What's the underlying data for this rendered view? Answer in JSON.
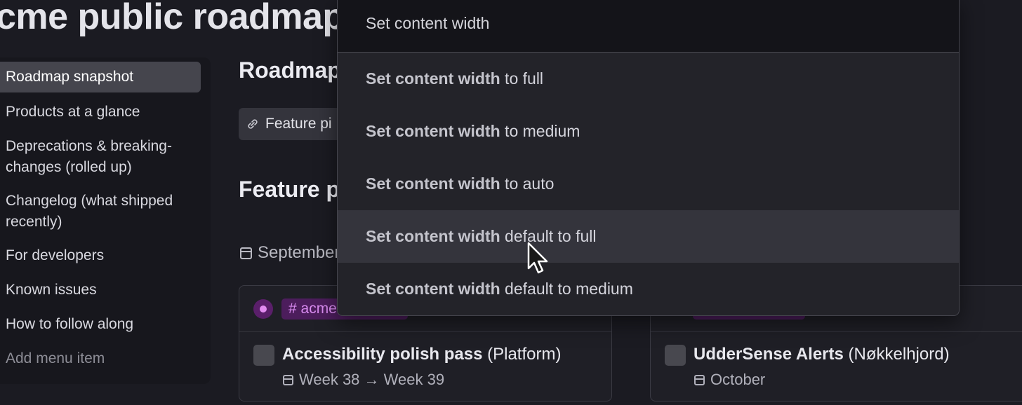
{
  "page_title": "cme public roadmap",
  "sidebar": {
    "items": [
      {
        "label": "Roadmap snapshot"
      },
      {
        "label": "Products at a glance"
      },
      {
        "label": "Deprecations & breaking-changes (rolled up)"
      },
      {
        "label": "Changelog (what shipped recently)"
      },
      {
        "label": "For developers"
      },
      {
        "label": "Known issues"
      },
      {
        "label": "How to follow along"
      }
    ],
    "add_label": "Add menu item"
  },
  "main": {
    "heading1": "Roadmap",
    "chip_label": "Feature pi",
    "heading2": "Feature p",
    "date_label": "September"
  },
  "cards": [
    {
      "tag": "# acme",
      "title": "Accessibility polish pass",
      "team": "(Platform)",
      "schedule": "Week 38 → Week 39"
    },
    {
      "title": "UdderSense Alerts",
      "team": "(Nøkkelhjord)",
      "schedule": "October"
    }
  ],
  "menu": {
    "query": "Set content width",
    "options": [
      {
        "bold": "Set content width",
        "rest": " to full"
      },
      {
        "bold": "Set content width",
        "rest": " to medium"
      },
      {
        "bold": "Set content width",
        "rest": " to auto"
      },
      {
        "bold": "Set content width",
        "rest": " default to full"
      },
      {
        "bold": "Set content width",
        "rest": " default to medium"
      }
    ],
    "hovered_index": 3
  },
  "colors": {
    "background": "#1b1b22",
    "menu_bg": "#232329",
    "hover_bg": "#34343c",
    "tag_purple": "#d98bf0"
  }
}
